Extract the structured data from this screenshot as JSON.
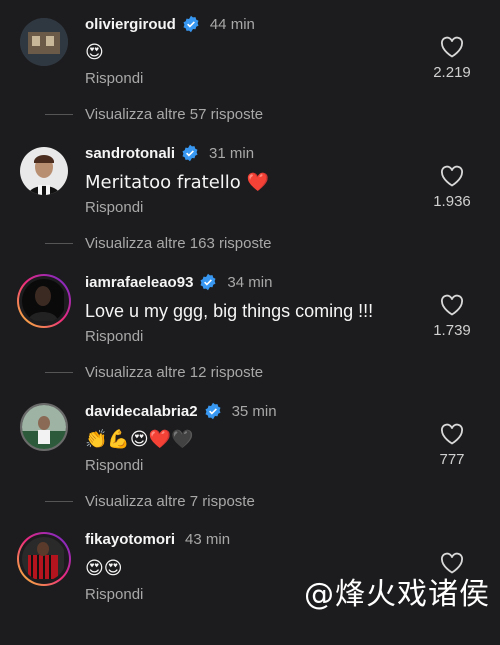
{
  "comments": [
    {
      "username": "oliviergiroud",
      "time": "44 min",
      "text": "😍",
      "reply": "Rispondi",
      "likes": "2.219",
      "more": "Visualizza altre 57 risposte"
    },
    {
      "username": "sandrotonali",
      "time": "31 min",
      "text": "Meritatoo fratello ❤️",
      "reply": "Rispondi",
      "likes": "1.936",
      "more": "Visualizza altre 163 risposte"
    },
    {
      "username": "iamrafaeleao93",
      "time": "34 min",
      "text": "Love u my ggg, big things coming !!!",
      "reply": "Rispondi",
      "likes": "1.739",
      "more": "Visualizza altre 12 risposte"
    },
    {
      "username": "davidecalabria2",
      "time": "35 min",
      "text": "👏💪😍❤️🖤",
      "reply": "Rispondi",
      "likes": "777",
      "more": "Visualizza altre 7 risposte"
    },
    {
      "username": "fikayotomori",
      "time": "43 min",
      "text": "😍😍",
      "reply": "Rispondi",
      "likes": ""
    }
  ],
  "watermark": "@烽火戏诸侯",
  "colors": {
    "background": "#1c1c1e",
    "verified": "#3897f0",
    "secondary_text": "#a8a8a8"
  }
}
